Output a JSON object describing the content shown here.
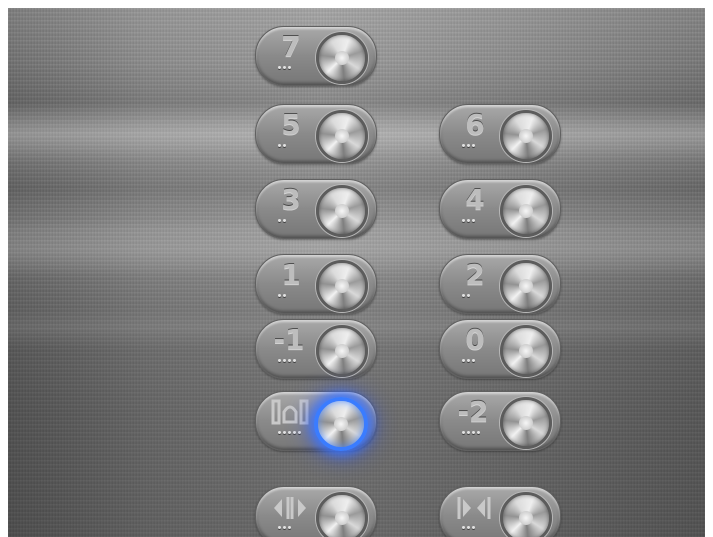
{
  "buttons": [
    {
      "id": "floor-7",
      "label": "7",
      "lit": false
    },
    {
      "id": "floor-5",
      "label": "5",
      "lit": false
    },
    {
      "id": "floor-6",
      "label": "6",
      "lit": false
    },
    {
      "id": "floor-3",
      "label": "3",
      "lit": false
    },
    {
      "id": "floor-4",
      "label": "4",
      "lit": false
    },
    {
      "id": "floor-1",
      "label": "1",
      "lit": false
    },
    {
      "id": "floor-2",
      "label": "2",
      "lit": false
    },
    {
      "id": "floor-m1",
      "label": "-1",
      "lit": false
    },
    {
      "id": "floor-0",
      "label": "0",
      "lit": false
    },
    {
      "id": "alarm",
      "icon": "alarm-bell-icon",
      "lit": true
    },
    {
      "id": "floor-m2",
      "label": "-2",
      "lit": false
    },
    {
      "id": "door-open",
      "icon": "door-open-icon",
      "lit": false
    },
    {
      "id": "door-close",
      "icon": "door-close-icon",
      "lit": false
    }
  ],
  "colors": {
    "steel": "#8f8f8f",
    "glow": "#3a7cff"
  }
}
